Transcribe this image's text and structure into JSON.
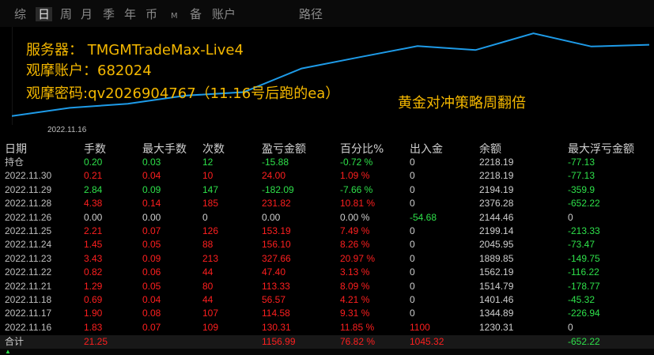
{
  "tabs": [
    {
      "label": "综",
      "active": false
    },
    {
      "label": "日",
      "active": true
    },
    {
      "label": "周",
      "active": false
    },
    {
      "label": "月",
      "active": false
    },
    {
      "label": "季",
      "active": false
    },
    {
      "label": "年",
      "active": false
    },
    {
      "label": "币",
      "active": false
    },
    {
      "label": "M",
      "active": false
    },
    {
      "label": "备",
      "active": false
    },
    {
      "label": "账户",
      "active": false
    },
    {
      "label": "路径",
      "active": false
    }
  ],
  "overlay": {
    "line1": "服务器： TMGMTradeMax-Live4",
    "line2": "观摩账户：682024",
    "line3": "观摩密码:qv2026904767（11.16号后跑的ea）",
    "tagline": "黄金对冲策略周翻倍"
  },
  "chart_data": {
    "type": "line",
    "x": [
      "2022.11.16",
      "2022.11.17",
      "2022.11.18",
      "2022.11.21",
      "2022.11.22",
      "2022.11.23",
      "2022.11.24",
      "2022.11.25",
      "2022.11.26",
      "2022.11.28",
      "2022.11.29",
      "2022.11.30"
    ],
    "series": [
      {
        "values": [
          1230.31,
          1344.89,
          1401.46,
          1514.79,
          1562.19,
          1889.85,
          2045.95,
          2199.14,
          2144.46,
          2376.28,
          2194.19,
          2218.19
        ]
      }
    ],
    "xtick_label": "2022.11.16",
    "line_color": "#1e9be8"
  },
  "table": {
    "headers": [
      "日期",
      "手数",
      "最大手数",
      "次数",
      "盈亏金额",
      "百分比%",
      "出入金",
      "余额",
      "最大浮亏金额"
    ],
    "rows": [
      {
        "cells": [
          "持仓",
          "0.20",
          "0.03",
          "12",
          "-15.88",
          "-0.72 %",
          "0",
          "2218.19",
          "-77.13"
        ],
        "tone": "green"
      },
      {
        "cells": [
          "2022.11.30",
          "0.21",
          "0.04",
          "10",
          "24.00",
          "1.09 %",
          "0",
          "2218.19",
          "-77.13"
        ],
        "tone": "red"
      },
      {
        "cells": [
          "2022.11.29",
          "2.84",
          "0.09",
          "147",
          "-182.09",
          "-7.66 %",
          "0",
          "2194.19",
          "-359.9"
        ],
        "tone": "green"
      },
      {
        "cells": [
          "2022.11.28",
          "4.38",
          "0.14",
          "185",
          "231.82",
          "10.81 %",
          "0",
          "2376.28",
          "-652.22"
        ],
        "tone": "red"
      },
      {
        "cells": [
          "2022.11.26",
          "0.00",
          "0.00",
          "0",
          "0.00",
          "0.00 %",
          "-54.68",
          "2144.46",
          "0"
        ],
        "tone": "white"
      },
      {
        "cells": [
          "2022.11.25",
          "2.21",
          "0.07",
          "126",
          "153.19",
          "7.49 %",
          "0",
          "2199.14",
          "-213.33"
        ],
        "tone": "red"
      },
      {
        "cells": [
          "2022.11.24",
          "1.45",
          "0.05",
          "88",
          "156.10",
          "8.26 %",
          "0",
          "2045.95",
          "-73.47"
        ],
        "tone": "red"
      },
      {
        "cells": [
          "2022.11.23",
          "3.43",
          "0.09",
          "213",
          "327.66",
          "20.97 %",
          "0",
          "1889.85",
          "-149.75"
        ],
        "tone": "red"
      },
      {
        "cells": [
          "2022.11.22",
          "0.82",
          "0.06",
          "44",
          "47.40",
          "3.13 %",
          "0",
          "1562.19",
          "-116.22"
        ],
        "tone": "red"
      },
      {
        "cells": [
          "2022.11.21",
          "1.29",
          "0.05",
          "80",
          "113.33",
          "8.09 %",
          "0",
          "1514.79",
          "-178.77"
        ],
        "tone": "red"
      },
      {
        "cells": [
          "2022.11.18",
          "0.69",
          "0.04",
          "44",
          "56.57",
          "4.21 %",
          "0",
          "1401.46",
          "-45.32"
        ],
        "tone": "red"
      },
      {
        "cells": [
          "2022.11.17",
          "1.90",
          "0.08",
          "107",
          "114.58",
          "9.31 %",
          "0",
          "1344.89",
          "-226.94"
        ],
        "tone": "red"
      },
      {
        "cells": [
          "2022.11.16",
          "1.83",
          "0.07",
          "109",
          "130.31",
          "11.85 %",
          "1100",
          "1230.31",
          "0"
        ],
        "tone": "red"
      }
    ],
    "total": {
      "cells": [
        "合计",
        "21.25",
        "",
        "",
        "1156.99",
        "76.82 %",
        "1045.32",
        "",
        "-652.22"
      ]
    }
  },
  "colors": {
    "green": "#2ee04a",
    "red": "#ff1f1f",
    "white": "#cfcfcf",
    "accent": "#f5b800",
    "line": "#1e9be8"
  }
}
